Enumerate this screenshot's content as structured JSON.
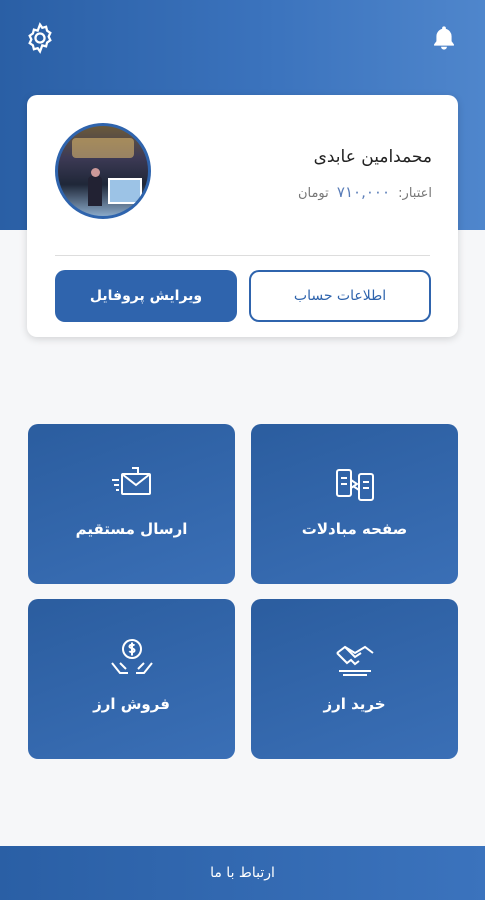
{
  "icons": {
    "settings": "gear-icon",
    "notifications": "bell-icon"
  },
  "profile": {
    "name": "محمدامین عابدی",
    "credit_label": "اعتبار:",
    "credit_amount": "۷۱۰,۰۰۰",
    "credit_unit": "تومان",
    "edit_button": "ویرایش پروفایل",
    "info_button": "اطلاعات حساب"
  },
  "tiles": {
    "send": "ارسال مستقیم",
    "exchanges": "صفحه مبادلات",
    "sell": "فروش ارز",
    "buy": "خرید ارز"
  },
  "footer": {
    "contact": "ارتباط با ما"
  },
  "colors": {
    "primary": "#2f64ad",
    "background": "#f6f7f9"
  }
}
